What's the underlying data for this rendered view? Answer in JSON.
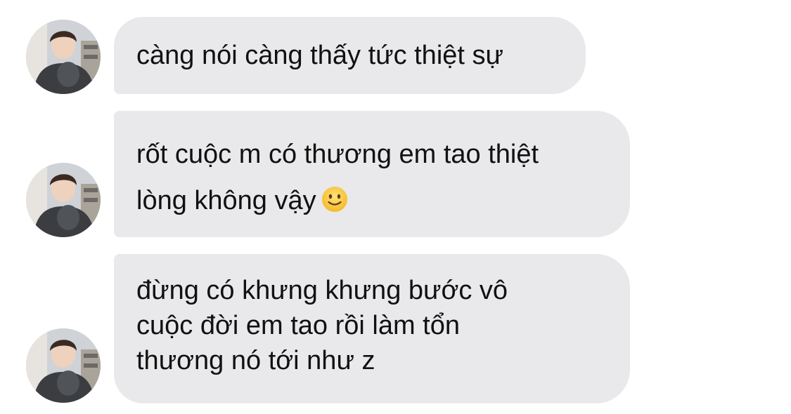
{
  "conversation": {
    "messages": [
      {
        "lines": [
          "càng nói càng thấy tức thiệt sự"
        ]
      },
      {
        "lines": [
          "rốt cuộc m có thương em tao thiệt",
          "lòng không vậy"
        ],
        "trailing_emoji": "slightly-smiling-face-emoji"
      },
      {
        "lines": [
          "đừng có khưng khưng bước vô",
          "cuộc đời em tao rồi làm tổn",
          "thương nó tới như z"
        ]
      }
    ]
  },
  "colors": {
    "bubble_background": "#e9e9eb",
    "text": "#111111",
    "page_background": "#ffffff"
  }
}
